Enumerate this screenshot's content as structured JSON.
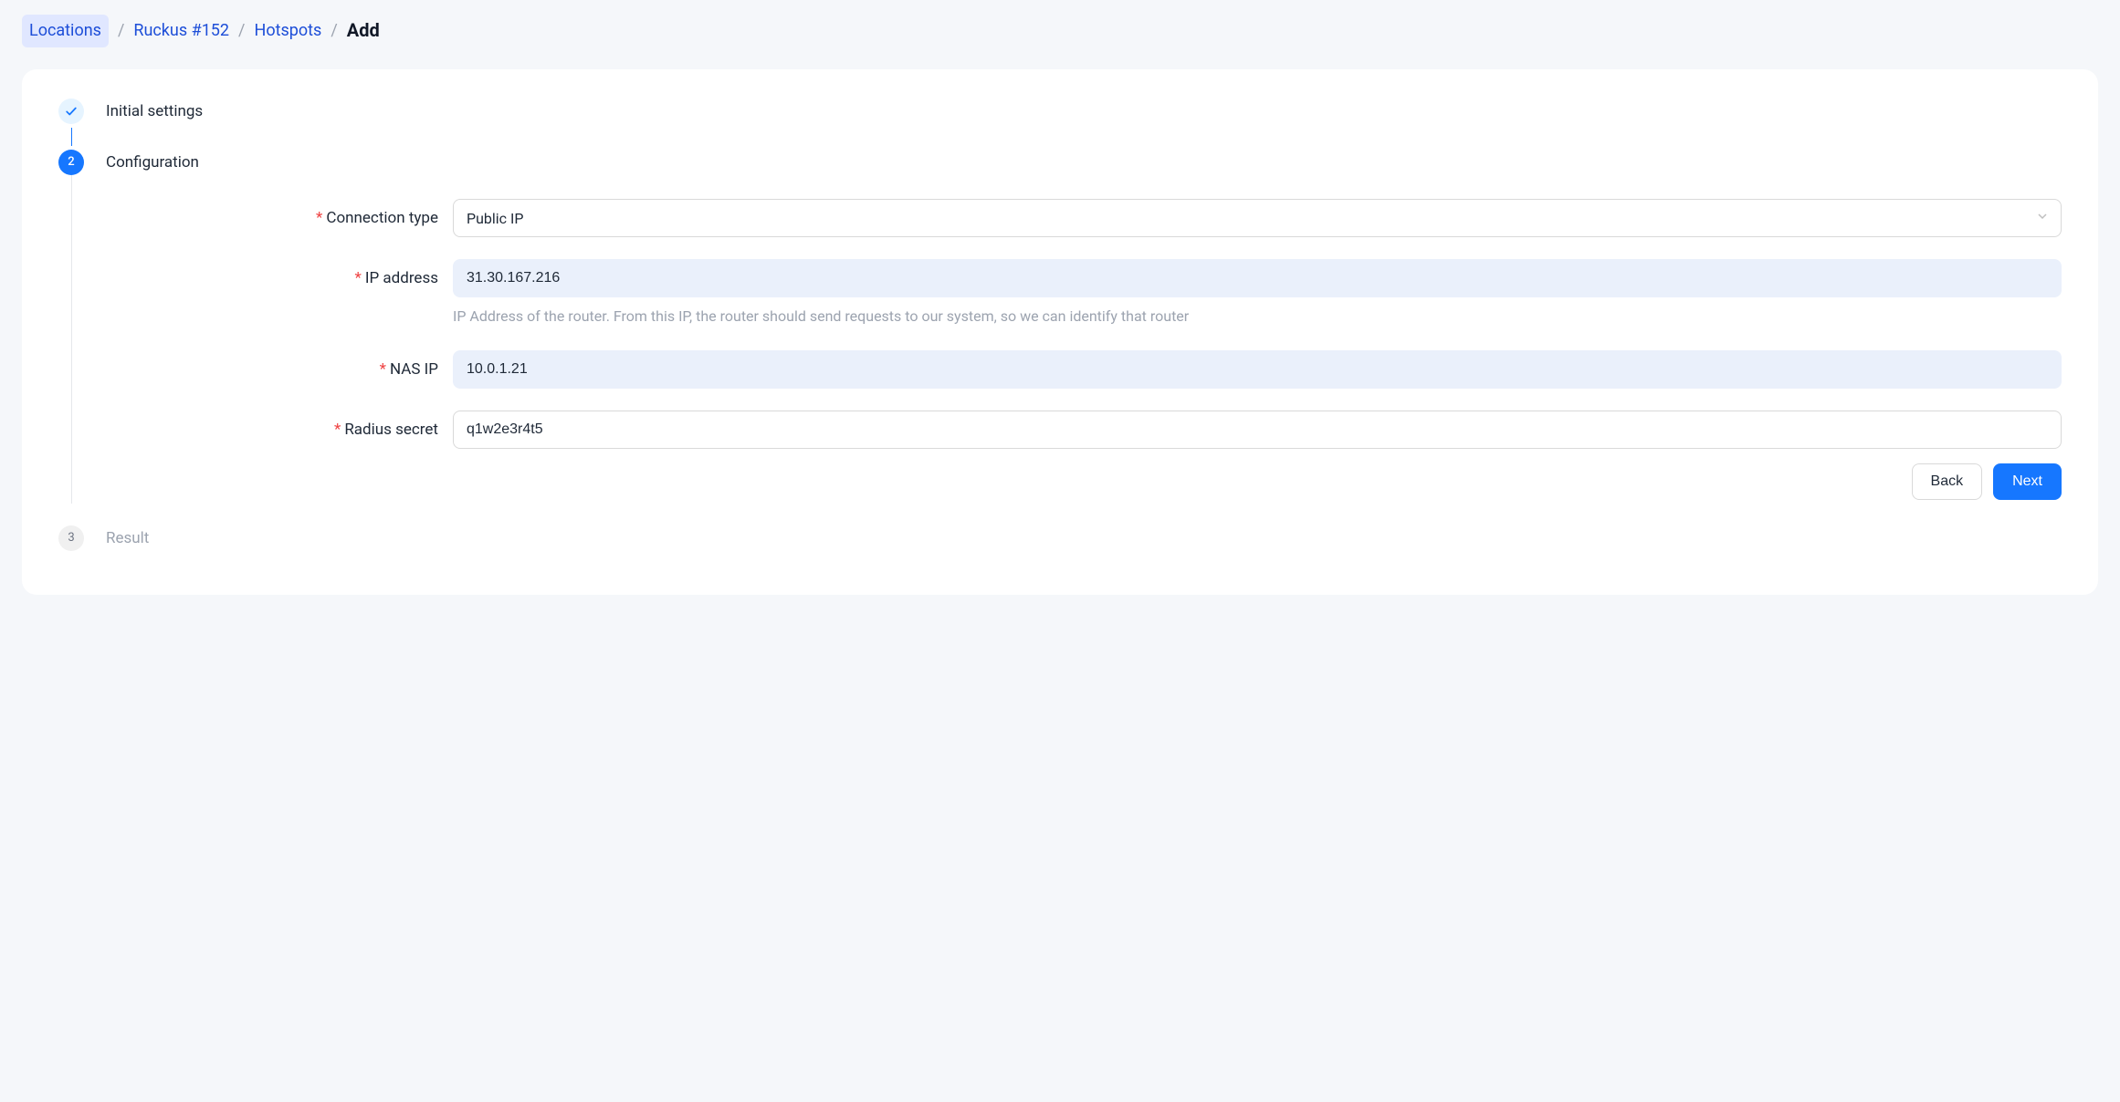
{
  "breadcrumb": {
    "locations": "Locations",
    "ruckus": "Ruckus #152",
    "hotspots": "Hotspots",
    "current": "Add"
  },
  "steps": {
    "initial": {
      "title": "Initial settings"
    },
    "configuration": {
      "title": "Configuration",
      "number": "2"
    },
    "result": {
      "title": "Result",
      "number": "3"
    }
  },
  "form": {
    "connection_type": {
      "label": "Connection type",
      "value": "Public IP"
    },
    "ip_address": {
      "label": "IP address",
      "value": "31.30.167.216",
      "help": "IP Address of the router. From this IP, the router should send requests to our system, so we can identify that router"
    },
    "nas_ip": {
      "label": "NAS IP",
      "value": "10.0.1.21"
    },
    "radius_secret": {
      "label": "Radius secret",
      "value": "q1w2e3r4t5"
    }
  },
  "actions": {
    "back": "Back",
    "next": "Next"
  }
}
